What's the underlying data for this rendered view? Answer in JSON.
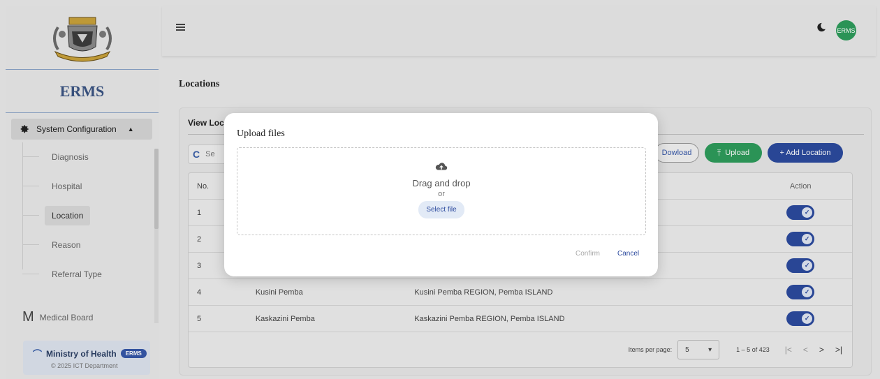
{
  "sidebar": {
    "brand": "ERMS",
    "section_label": "System Configuration",
    "items": [
      {
        "label": "Diagnosis"
      },
      {
        "label": "Hospital"
      },
      {
        "label": "Location"
      },
      {
        "label": "Reason"
      },
      {
        "label": "Referral Type"
      }
    ],
    "medical_letter": "M",
    "medical_label": "Medical Board",
    "footer": {
      "org": "Ministry of Health",
      "badge": "ERMS",
      "copyright": "© 2025 ICT Department"
    }
  },
  "header": {
    "avatar_text": "ERMS"
  },
  "page": {
    "title": "Locations",
    "card_title": "View Loc",
    "search_placeholder": "Se",
    "buttons": {
      "download": "Dowload",
      "upload": "Upload",
      "add": "+ Add Location"
    },
    "table": {
      "headers": {
        "no": "No.",
        "action": "Action"
      },
      "rows": [
        {
          "no": "1",
          "name": "",
          "desc": ""
        },
        {
          "no": "2",
          "name": "",
          "desc": ""
        },
        {
          "no": "3",
          "name": "",
          "desc": ""
        },
        {
          "no": "4",
          "name": "Kusini Pemba",
          "desc": "Kusini Pemba REGION, Pemba ISLAND"
        },
        {
          "no": "5",
          "name": "Kaskazini Pemba",
          "desc": "Kaskazini Pemba REGION, Pemba ISLAND"
        }
      ]
    },
    "paginator": {
      "label": "Items per page:",
      "page_size": "5",
      "range": "1 – 5 of 423"
    }
  },
  "dialog": {
    "title": "Upload files",
    "drag_text": "Drag and drop",
    "or_text": "or",
    "select_file": "Select file",
    "confirm": "Confirm",
    "cancel": "Cancel"
  },
  "colors": {
    "primary": "#2c4a9e",
    "success": "#2e9b5b"
  }
}
